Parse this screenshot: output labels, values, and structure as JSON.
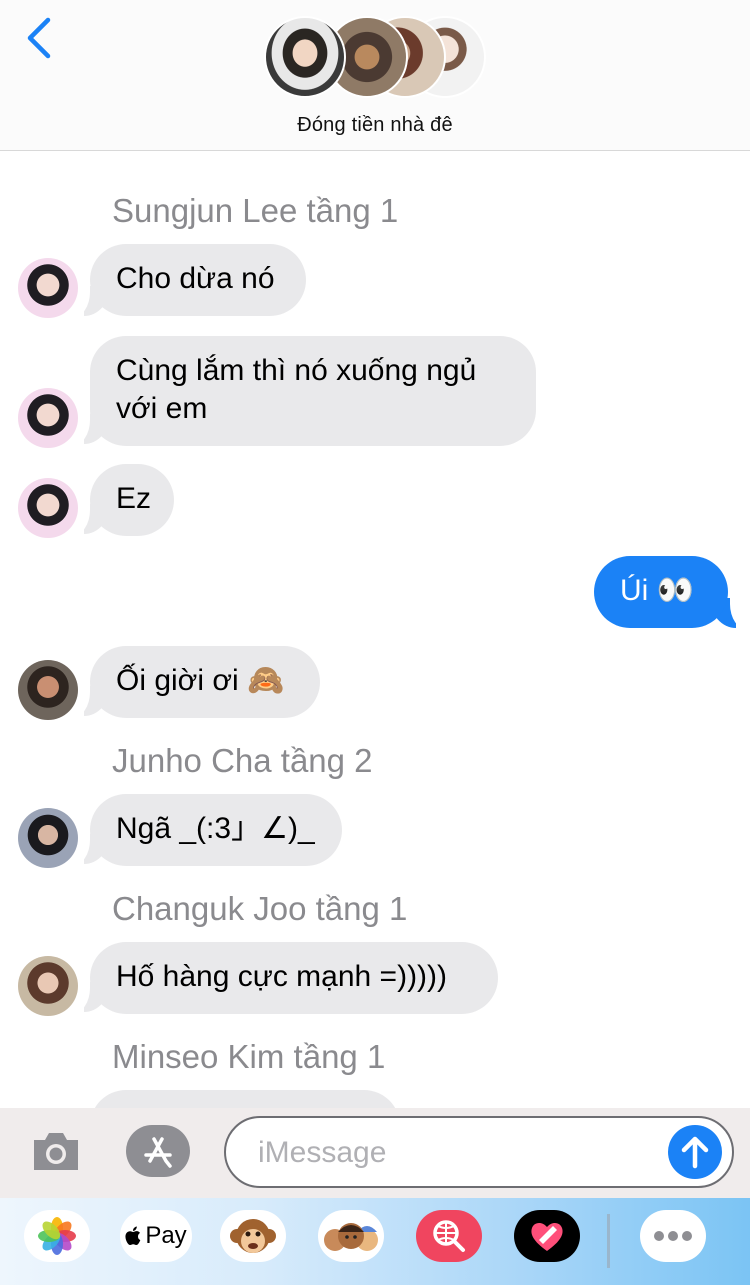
{
  "header": {
    "title": "Đóng tiền nhà đê"
  },
  "messages": [
    {
      "sender": "Sungjun Lee tầng 1"
    },
    {
      "text": "Cho dừa nó"
    },
    {
      "text_line1": "Cùng lắm thì nó xuống ngủ",
      "text_line2": "với em"
    },
    {
      "text": "Ez"
    },
    {
      "text": "Úi 👀"
    },
    {
      "text": "Ối giời ơi 🙈"
    },
    {
      "sender": "Junho Cha tầng 2"
    },
    {
      "text": "Ngã _(:3」∠)_"
    },
    {
      "sender": "Changuk Joo tầng 1"
    },
    {
      "text": "Hố hàng cực mạnh =)))))"
    },
    {
      "sender": "Minseo Kim tầng 1"
    }
  ],
  "input": {
    "placeholder": "iMessage",
    "value": ""
  },
  "apps": {
    "apple_pay_label": "Pay"
  },
  "colors": {
    "accent": "#1b82f6",
    "incoming_bubble": "#e9e9eb",
    "sender_name": "#8a8a8e"
  },
  "icons": [
    "chevron-left-icon",
    "camera-icon",
    "app-store-icon",
    "arrow-up-icon",
    "photos-icon",
    "apple-pay-icon",
    "animoji-icon",
    "memoji-icon",
    "web-search-icon",
    "digital-touch-icon",
    "more-icon"
  ]
}
